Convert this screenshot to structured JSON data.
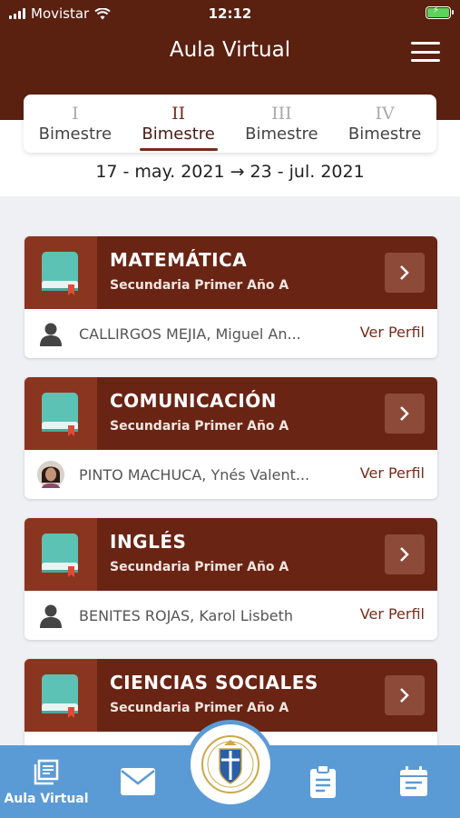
{
  "status_bar": {
    "carrier": "Movistar",
    "time": "12:12"
  },
  "header": {
    "title": "Aula Virtual",
    "menu_icon": "hamburger-menu-icon"
  },
  "terms": {
    "tabs": [
      {
        "numeral": "I",
        "label": "Bimestre",
        "active": false
      },
      {
        "numeral": "II",
        "label": "Bimestre",
        "active": true
      },
      {
        "numeral": "III",
        "label": "Bimestre",
        "active": false
      },
      {
        "numeral": "IV",
        "label": "Bimestre",
        "active": false
      }
    ],
    "date_range": "17 - may. 2021 → 23 - jul. 2021"
  },
  "courses": [
    {
      "name": "MATEMÁTICA",
      "level": "Secundaria Primer Año A",
      "teacher": "CALLIRGOS MEJIA, Miguel An...",
      "profile_link": "Ver Perfil",
      "avatar": "person-silhouette-icon"
    },
    {
      "name": "COMUNICACIÓN",
      "level": "Secundaria Primer Año A",
      "teacher": "PINTO MACHUCA, Ynés Valent...",
      "profile_link": "Ver Perfil",
      "avatar": "teacher-photo"
    },
    {
      "name": "INGLÉS",
      "level": "Secundaria Primer Año A",
      "teacher": "BENITES ROJAS, Karol Lisbeth",
      "profile_link": "Ver Perfil",
      "avatar": "person-silhouette-icon"
    },
    {
      "name": "CIENCIAS SOCIALES",
      "level": "Secundaria Primer Año A",
      "teacher": "",
      "profile_link": "",
      "avatar": ""
    }
  ],
  "bottom_nav": {
    "items": [
      {
        "label": "Aula Virtual",
        "icon": "book-icon"
      },
      {
        "label": "",
        "icon": "mail-icon"
      },
      {
        "label": "",
        "icon": "school-crest"
      },
      {
        "label": "",
        "icon": "clipboard-icon"
      },
      {
        "label": "",
        "icon": "calendar-icon"
      }
    ]
  },
  "colors": {
    "header": "#5a2010",
    "card_header": "#6a2414",
    "accent": "#7a2a1a",
    "bottom_nav": "#5b9bd5"
  }
}
